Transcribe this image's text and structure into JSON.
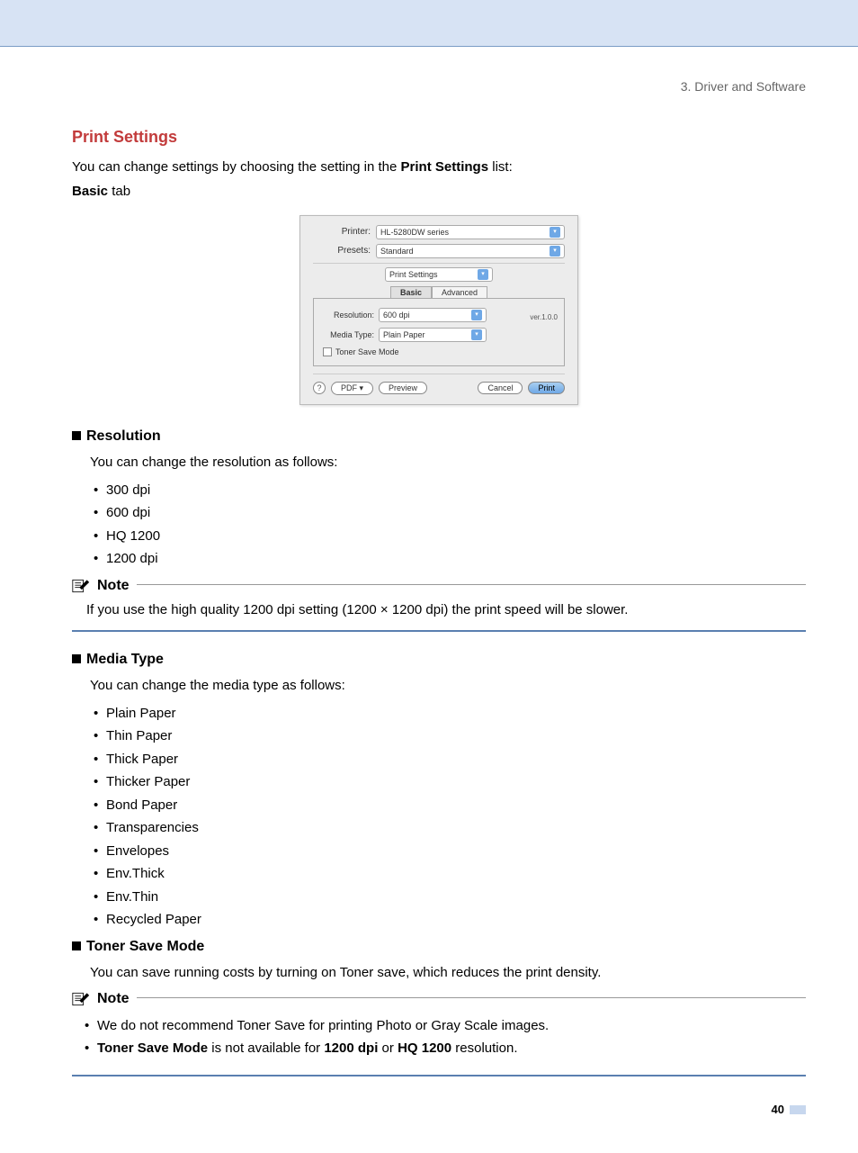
{
  "breadcrumb": "3. Driver and Software",
  "heading": "Print Settings",
  "intro_pre": "You can change settings by choosing the setting in the ",
  "intro_bold": "Print Settings",
  "intro_post": " list:",
  "basic_bold": "Basic",
  "basic_tab_word": " tab",
  "dialog": {
    "printer_label": "Printer:",
    "printer_value": "HL-5280DW series",
    "presets_label": "Presets:",
    "presets_value": "Standard",
    "panel_value": "Print Settings",
    "tab_basic": "Basic",
    "tab_advanced": "Advanced",
    "version": "ver.1.0.0",
    "resolution_label": "Resolution:",
    "resolution_value": "600 dpi",
    "media_label": "Media Type:",
    "media_value": "Plain Paper",
    "toner_save": "Toner Save Mode",
    "help": "?",
    "pdf_btn": "PDF ▾",
    "preview_btn": "Preview",
    "cancel_btn": "Cancel",
    "print_btn": "Print"
  },
  "resolution": {
    "title": "Resolution",
    "intro": "You can change the resolution as follows:",
    "items": [
      "300 dpi",
      "600 dpi",
      "HQ 1200",
      "1200 dpi"
    ]
  },
  "note1": {
    "title": "Note",
    "text": "If you use the high quality 1200 dpi setting (1200 × 1200 dpi) the print speed will be slower."
  },
  "media": {
    "title": "Media Type",
    "intro": "You can change the media type as follows:",
    "items": [
      "Plain Paper",
      "Thin Paper",
      "Thick Paper",
      "Thicker Paper",
      "Bond Paper",
      "Transparencies",
      "Envelopes",
      "Env.Thick",
      "Env.Thin",
      "Recycled Paper"
    ]
  },
  "toner": {
    "title": "Toner Save Mode",
    "text": "You can save running costs by turning on Toner save, which reduces the print density."
  },
  "note2": {
    "title": "Note",
    "line1": "We do not recommend Toner Save for printing Photo or Gray Scale images.",
    "line2_b1": "Toner Save Mode",
    "line2_mid": " is not available for ",
    "line2_b2": "1200 dpi",
    "line2_or": " or ",
    "line2_b3": "HQ 1200",
    "line2_end": " resolution."
  },
  "page_number": "40"
}
